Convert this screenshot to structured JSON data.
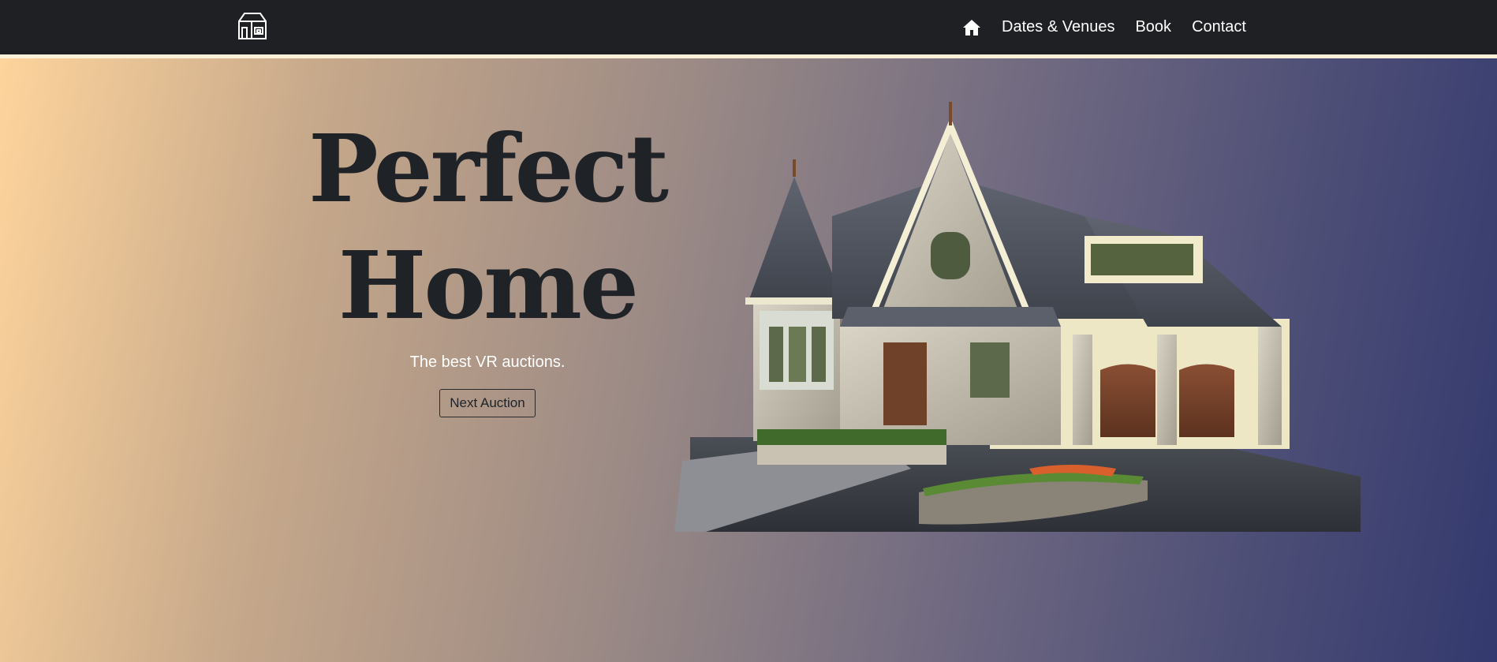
{
  "nav": {
    "logo_icon": "house-outline-icon",
    "home_icon": "home-icon",
    "links": [
      "Dates & Venues",
      "Book",
      "Contact"
    ]
  },
  "hero": {
    "title_line1": "Perfect",
    "title_line2": "Home",
    "subtitle": "The best VR auctions.",
    "cta_label": "Next Auction",
    "image": "house-image"
  },
  "colors": {
    "navbar": "#1e2023",
    "nav_border": "#fbf1d9",
    "gradient_start": "#fed49c",
    "gradient_end": "#33396e",
    "title": "#1f2226"
  }
}
